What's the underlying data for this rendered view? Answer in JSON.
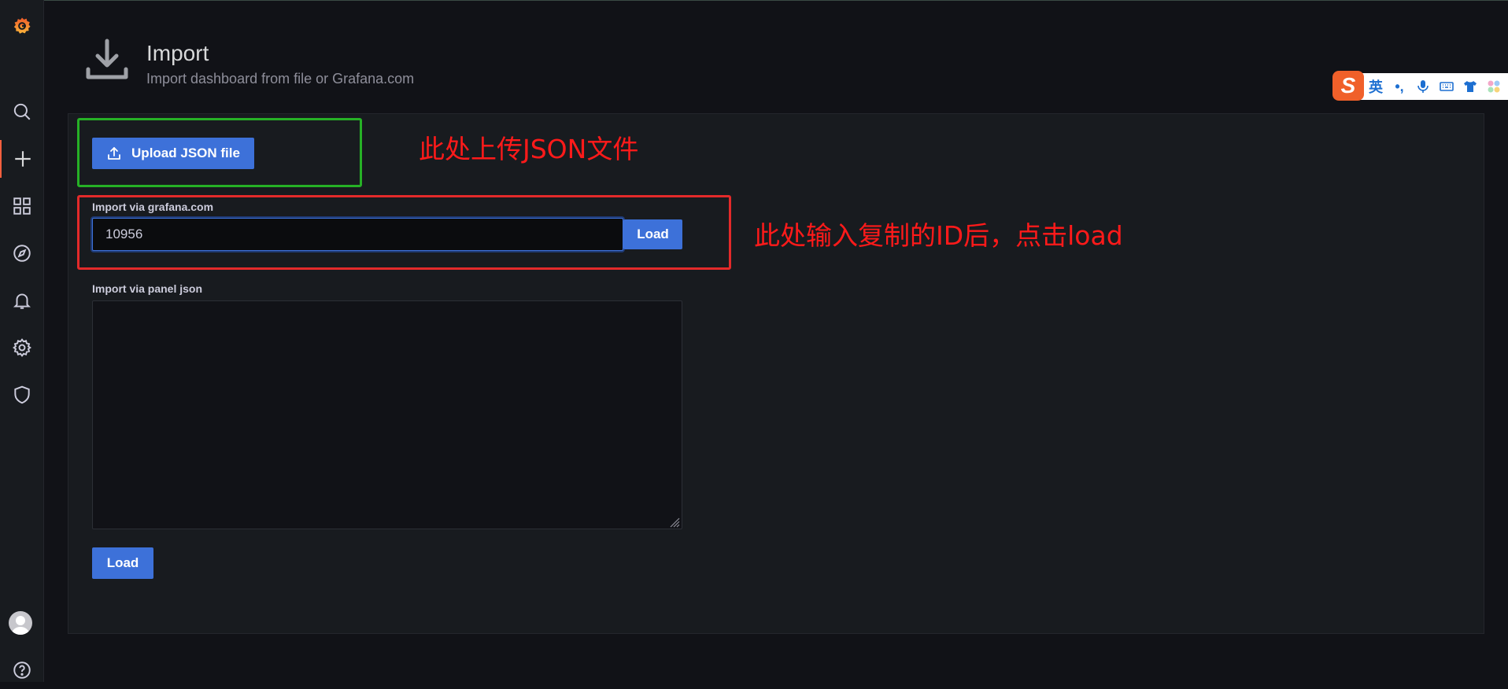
{
  "header": {
    "title": "Import",
    "subtitle": "Import dashboard from file or Grafana.com"
  },
  "sidebar": {
    "items": [
      {
        "icon": "grafana-logo-icon"
      },
      {
        "icon": "search-icon"
      },
      {
        "icon": "plus-icon",
        "active": true
      },
      {
        "icon": "dashboards-grid-icon"
      },
      {
        "icon": "explore-compass-icon"
      },
      {
        "icon": "bell-icon"
      },
      {
        "icon": "gear-icon"
      },
      {
        "icon": "shield-icon"
      },
      {
        "icon": "avatar-icon"
      },
      {
        "icon": "help-icon"
      }
    ]
  },
  "upload": {
    "button_label": "Upload JSON file"
  },
  "grafana_import": {
    "label": "Import via grafana.com",
    "value": "10956",
    "load_label": "Load"
  },
  "panel_json": {
    "label": "Import via panel json",
    "value": "",
    "load_label": "Load"
  },
  "annotations": {
    "upload_note": "此处上传JSON文件",
    "load_note": "此处输入复制的ID后，点击load"
  },
  "ime_toolbar": {
    "logo": "S",
    "mode": "英",
    "punct": "•,"
  },
  "colors": {
    "accent": "#3d71d9",
    "annotation_red": "#e32a2a",
    "annotation_green": "#26b126",
    "grafana_orange": "#f55f3e"
  }
}
